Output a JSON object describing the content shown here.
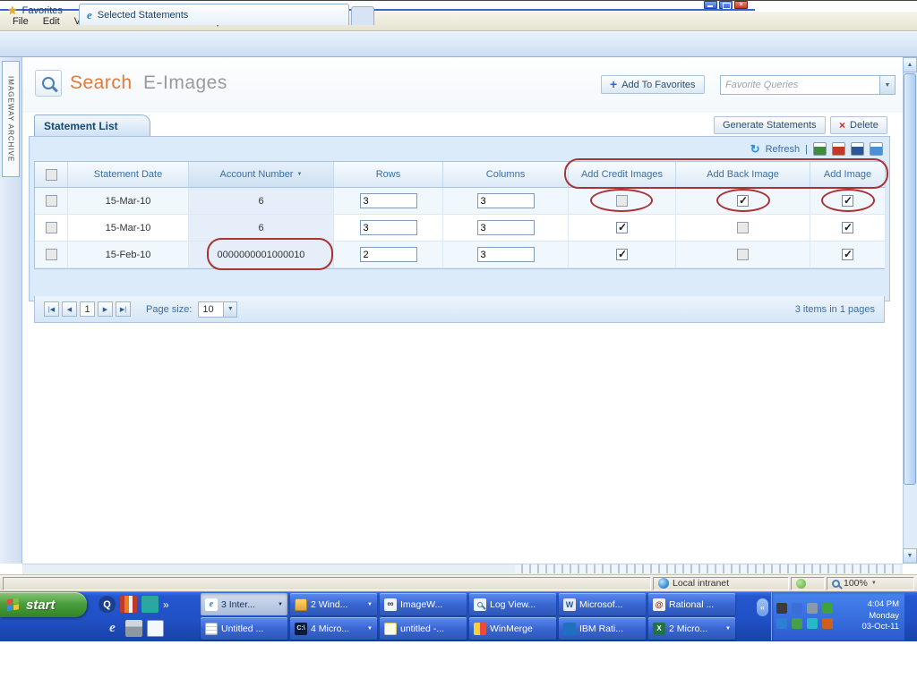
{
  "window": {
    "menu_items": [
      "File",
      "Edit",
      "View",
      "Favorites",
      "Tools",
      "Help"
    ],
    "favorites_button": "Favorites",
    "tab_title": "Selected Statements"
  },
  "left_rail": {
    "vertical_label": "IMAGEWAY ARCHIVE"
  },
  "header": {
    "title_primary": "Search",
    "title_secondary": "E-Images",
    "add_to_favorites": "Add To Favorites",
    "favorite_queries": "Favorite Queries"
  },
  "toolbar": {
    "tab_label": "Statement List",
    "generate": "Generate Statements",
    "delete": "Delete",
    "refresh": "Refresh",
    "separator": "|"
  },
  "grid": {
    "columns": [
      "Statement Date",
      "Account Number",
      "Rows",
      "Columns",
      "Add Credit Images",
      "Add Back Image",
      "Add Image"
    ],
    "rows": [
      {
        "date": "15-Mar-10",
        "account": "6",
        "rows": "3",
        "columns": "3",
        "add_credit": false,
        "add_back": true,
        "add_image": true
      },
      {
        "date": "15-Mar-10",
        "account": "6",
        "rows": "3",
        "columns": "3",
        "add_credit": true,
        "add_back": false,
        "add_image": true
      },
      {
        "date": "15-Feb-10",
        "account": "0000000001000010",
        "rows": "2",
        "columns": "3",
        "add_credit": true,
        "add_back": false,
        "add_image": true
      }
    ],
    "pager": {
      "first": "|◀",
      "prev": "◀",
      "page": "1",
      "next": "▶",
      "last": "▶|",
      "page_size_label": "Page size:",
      "page_size": "10",
      "summary": "3 items in 1 pages"
    }
  },
  "status_bar": {
    "zone": "Local intranet",
    "zoom": "100%"
  },
  "taskbar": {
    "start_label": "start",
    "row1": [
      {
        "label": "3 Inter...",
        "menu": true
      },
      {
        "label": "2 Wind...",
        "menu": true
      },
      {
        "label": "ImageW...",
        "menu": false
      },
      {
        "label": "Log View...",
        "menu": false
      },
      {
        "label": "Microsof...",
        "menu": false
      },
      {
        "label": "Rational ...",
        "menu": false
      }
    ],
    "row2": [
      {
        "label": "Untitled ...",
        "menu": false
      },
      {
        "label": "4 Micro...",
        "menu": true
      },
      {
        "label": "untitled -...",
        "menu": false
      },
      {
        "label": "WinMerge",
        "menu": false
      },
      {
        "label": "IBM Rati...",
        "menu": false
      },
      {
        "label": "2 Micro...",
        "menu": true
      }
    ],
    "clock": {
      "time": "4:04 PM",
      "day": "Monday",
      "date": "03-Oct-11"
    }
  },
  "icons": {
    "star": "★",
    "plus": "+",
    "close": "×",
    "refresh": "↻",
    "dropdown": "▼",
    "sort": "▼",
    "up": "▲",
    "down": "▼",
    "chevron_more": "»",
    "chevron_collapse": "«",
    "infinity": "∞",
    "q": "Q",
    "e": "e",
    "at": "@",
    "w": "W",
    "cmd": "C:\\",
    "xl": "X"
  }
}
